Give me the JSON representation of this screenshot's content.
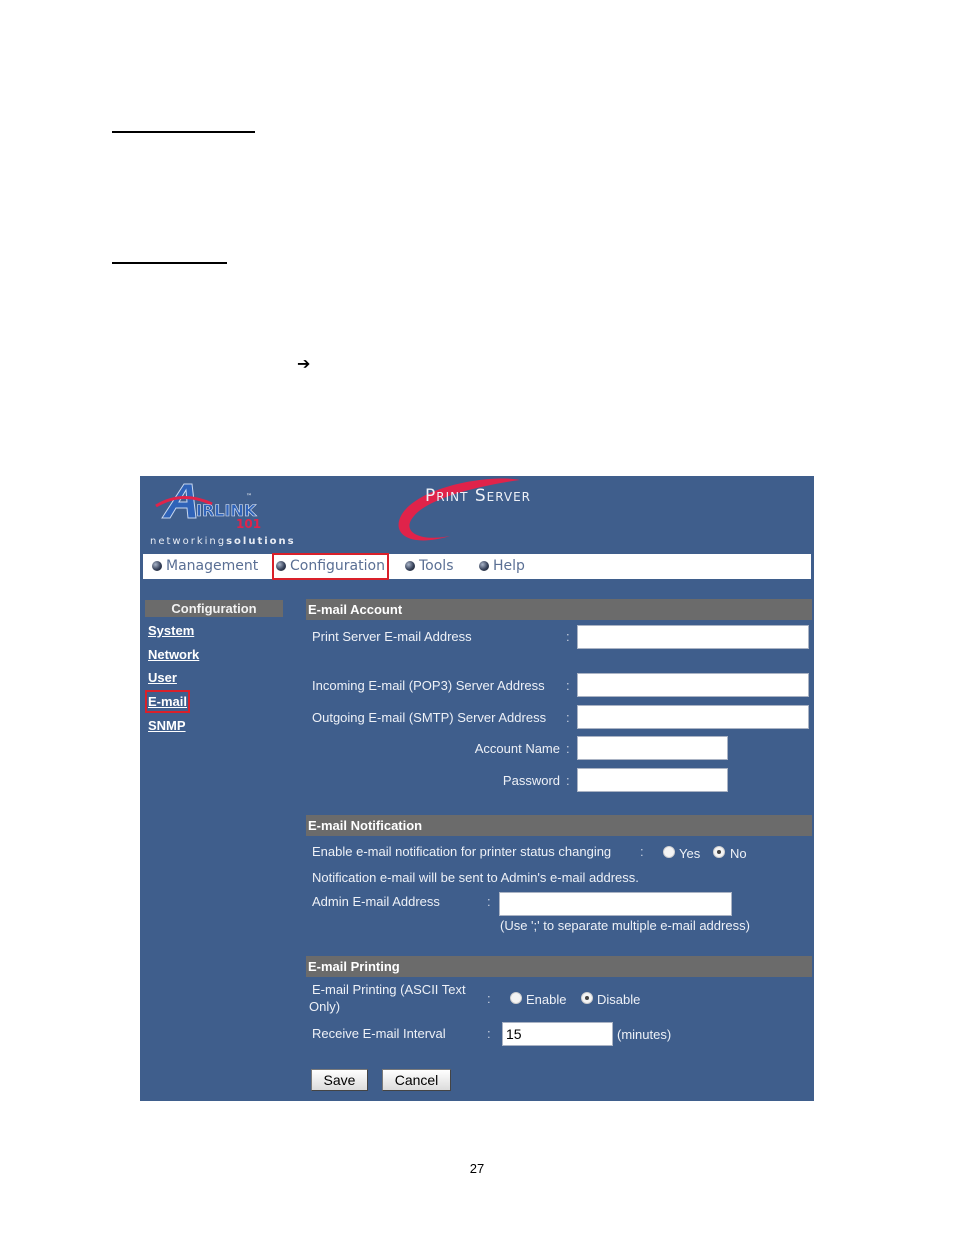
{
  "document": {
    "page_number": "27",
    "arrow_glyph": "➔"
  },
  "screenshot": {
    "logo": {
      "brand": "AIRLINK",
      "brand_number": "101",
      "tagline_regular": "networking",
      "tagline_bold": "solutions"
    },
    "product_title": "Print Server",
    "topnav": [
      {
        "label": "Management",
        "active": false
      },
      {
        "label": "Configuration",
        "active": true
      },
      {
        "label": "Tools",
        "active": false
      },
      {
        "label": "Help",
        "active": false
      }
    ],
    "sidebar": {
      "heading": "Configuration",
      "items": [
        {
          "label": "System",
          "active": false
        },
        {
          "label": "Network",
          "active": false
        },
        {
          "label": "User",
          "active": false
        },
        {
          "label": "E-mail",
          "active": true
        },
        {
          "label": "SNMP",
          "active": false
        }
      ]
    },
    "email_account": {
      "heading": "E-mail Account",
      "fields": [
        {
          "label": "Print Server E-mail Address",
          "value": ""
        },
        {
          "label": "Incoming E-mail (POP3) Server Address",
          "value": ""
        },
        {
          "label": "Outgoing E-mail (SMTP) Server Address",
          "value": ""
        },
        {
          "label": "Account Name",
          "value": ""
        },
        {
          "label": "Password",
          "value": ""
        }
      ]
    },
    "email_notification": {
      "heading": "E-mail Notification",
      "enable_label": "Enable e-mail notification for printer status changing",
      "options": [
        {
          "label": "Yes",
          "checked": false
        },
        {
          "label": "No",
          "checked": true
        }
      ],
      "note": "Notification e-mail will be sent to Admin's e-mail address.",
      "admin_label": "Admin E-mail Address",
      "admin_value": "",
      "admin_hint": "(Use ';' to separate multiple e-mail address)"
    },
    "email_printing": {
      "heading": "E-mail Printing",
      "printing_label_line1": "E-mail Printing (ASCII Text",
      "printing_label_line2": "Only)",
      "options": [
        {
          "label": "Enable",
          "checked": false
        },
        {
          "label": "Disable",
          "checked": true
        }
      ],
      "interval_label": "Receive E-mail Interval",
      "interval_value": "15",
      "interval_unit": "(minutes)"
    },
    "buttons": {
      "save": "Save",
      "cancel": "Cancel"
    },
    "colors": {
      "background": "#3f5e8c",
      "section_header": "#6b6b6b",
      "highlight": "#d9202a",
      "swoosh": "#e0234a"
    },
    "colon": ":"
  }
}
